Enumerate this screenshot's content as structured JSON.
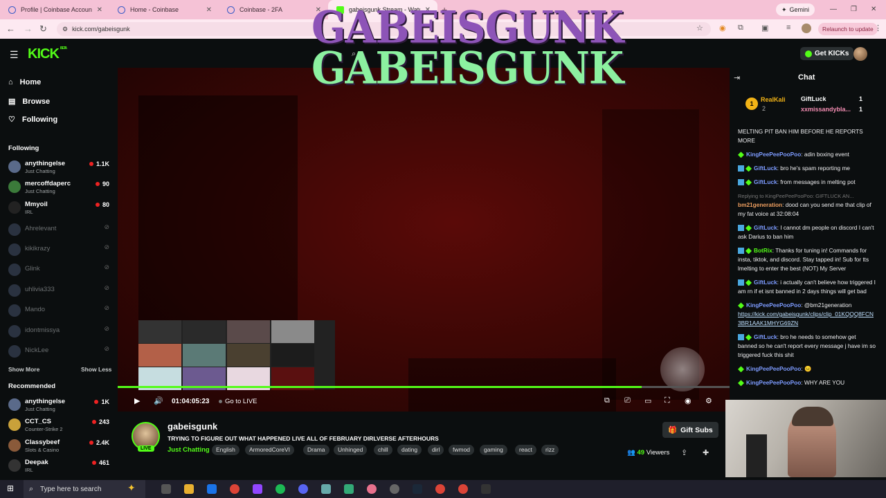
{
  "browser": {
    "tabs": [
      {
        "title": "Profile | Coinbase Account"
      },
      {
        "title": "Home - Coinbase"
      },
      {
        "title": "Coinbase - 2FA"
      },
      {
        "title": "gabeisgunk Stream - Watch Liv"
      }
    ],
    "gemini_label": "Gemini",
    "url": "kick.com/gabeisgunk",
    "relaunch_label": "Relaunch to update"
  },
  "site": {
    "logo": "KICK",
    "logo_badge": "BETA",
    "get_kicks_label": "Get KICKs"
  },
  "overlay_text": {
    "line1": "GABEISGUNK",
    "line2": "GABEISGUNK"
  },
  "sidebar": {
    "nav": [
      {
        "label": "Home",
        "icon": "home-icon"
      },
      {
        "label": "Browse",
        "icon": "browse-icon"
      },
      {
        "label": "Following",
        "icon": "heart-icon"
      }
    ],
    "following_heading": "Following",
    "following": [
      {
        "name": "anythingelse",
        "category": "Just Chatting",
        "viewers": "1.1K",
        "live": true
      },
      {
        "name": "mercoffdaperc",
        "category": "Just Chatting",
        "viewers": "90",
        "live": true
      },
      {
        "name": "Mmyoil",
        "category": "IRL",
        "viewers": "80",
        "live": true
      },
      {
        "name": "Ahrelevant",
        "live": false
      },
      {
        "name": "kikikrazy",
        "live": false
      },
      {
        "name": "Glink",
        "live": false
      },
      {
        "name": "uhlivia333",
        "live": false
      },
      {
        "name": "Mando",
        "live": false
      },
      {
        "name": "idontmissya",
        "live": false
      },
      {
        "name": "NickLee",
        "live": false
      }
    ],
    "show_more": "Show More",
    "show_less": "Show Less",
    "recommended_heading": "Recommended",
    "recommended": [
      {
        "name": "anythingelse",
        "category": "Just Chatting",
        "viewers": "1K"
      },
      {
        "name": "CCT_CS",
        "category": "Counter-Strike 2",
        "viewers": "243"
      },
      {
        "name": "Classybeef",
        "category": "Slots & Casino",
        "viewers": "2.4K"
      },
      {
        "name": "Deepak",
        "category": "IRL",
        "viewers": "461"
      }
    ]
  },
  "player": {
    "time": "01:04:05:23",
    "go_live": "Go to LIVE",
    "progress": 0.856
  },
  "stream": {
    "streamer": "gabeisgunk",
    "live_badge": "LIVE",
    "title": "TRYING TO FIGURE OUT WHAT HAPPENED  LIVE ALL OF FEBRUARY DIRLVERSE AFTERHOURS",
    "category": "Just Chatting",
    "tags": [
      "English",
      "ArmoredCoreVI",
      "Drama",
      "Unhinged",
      "chill",
      "dating",
      "dirl",
      "fwmod",
      "gaming",
      "react",
      "rizz"
    ],
    "gift_subs_label": "Gift Subs",
    "viewers_count": "49",
    "viewers_label": "Viewers"
  },
  "chat": {
    "title": "Chat",
    "leaderboard": [
      {
        "rank": "1",
        "name": "RealKali",
        "count": "2"
      },
      {
        "name": "GiftLuck",
        "count": "1"
      },
      {
        "name": "xxmissandybla...",
        "count": "1"
      }
    ],
    "messages": [
      {
        "user": "",
        "text": "MELTING PIT BAN HIM BEFORE HE REPORTS MORE"
      },
      {
        "user": "KingPeePeePooPoo",
        "text": ": adin boxing event"
      },
      {
        "user": "GiftLuck",
        "text": ": bro he's spam reporting me"
      },
      {
        "user": "GiftLuck",
        "text": ": from messages in melting pot"
      },
      {
        "reply": "Replying to KingPeePeePooPoo: GIFTLUCK AN...",
        "user": "bm21generation",
        "text": ": dood can you send me that clip of my fat voice at 32:08:04"
      },
      {
        "user": "GiftLuck",
        "text": ": I cannot dm people on discord I can't ask Darius to ban him"
      },
      {
        "user": "BotRix",
        "text": ": Thanks for tuning in! Commands for insta, tiktok, and discord. Stay tapped in! Sub for tts lmelting to enter the best (NOT) My Server"
      },
      {
        "user": "GiftLuck",
        "text": ": i actually can't believe how triggered I am rn if et isnt banned in 2 days things will get bad"
      },
      {
        "user": "KingPeePeePooPoo",
        "text": ": @bm21generation",
        "link": "https://kick.com/gabeisgunk/clips/clip_01KQQQ8FCN3BR1AAK1MHYG69ZN"
      },
      {
        "user": "GiftLuck",
        "text": ": bro he needs to somehow get banned so he can't report every message j have im so triggered fuck this shit"
      },
      {
        "user": "KingPeePeePooPoo",
        "text": ":"
      },
      {
        "user": "KingPeePeePooPoo",
        "text": ": WHY ARE YOU"
      }
    ]
  },
  "taskbar": {
    "search_placeholder": "Type here to search"
  },
  "colors": {
    "accent": "#53fc18",
    "tab_bar": "#f5c2d6",
    "bg": "#0b0e0f"
  }
}
